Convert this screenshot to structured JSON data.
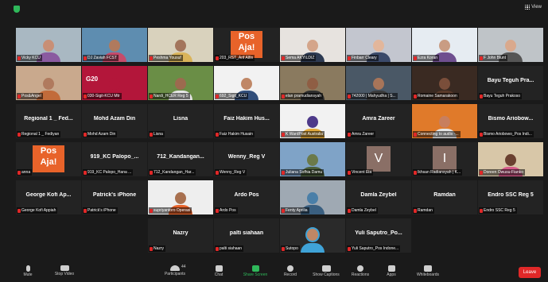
{
  "app": {
    "view_label": "View"
  },
  "tiles": [
    {
      "row": 0,
      "col": 0,
      "label": "Vicky KCU",
      "style": "photo",
      "bg": "#a9b8c2",
      "skin": "#c88f76",
      "shirt": "#8a5aa0",
      "active": true
    },
    {
      "row": 0,
      "col": 1,
      "label": "DJ Zaviah FCST",
      "style": "photo",
      "bg": "#5e8db0",
      "skin": "#b07a5e",
      "shirt": "#c64b6a"
    },
    {
      "row": 0,
      "col": 2,
      "label": "Peshma Yousuf",
      "style": "photo",
      "bg": "#d9d2bd",
      "skin": "#a3755c",
      "shirt": "#dab45a"
    },
    {
      "row": 0,
      "col": 3,
      "label": "203_RST_Arif Alfin",
      "style": "logo",
      "text": "Pos Aja!"
    },
    {
      "row": 0,
      "col": 4,
      "label": "Sema AKYILDIZ",
      "style": "photo",
      "bg": "#e7e3df",
      "skin": "#d4a58a",
      "shirt": "#2d3a52"
    },
    {
      "row": 0,
      "col": 5,
      "label": "Finbarr Cleary",
      "style": "photo",
      "bg": "#c3c6cf",
      "skin": "#e2b69b",
      "shirt": "#3b4a6a"
    },
    {
      "row": 0,
      "col": 6,
      "label": "Ezra Koran",
      "style": "photo",
      "bg": "#e6ecf2",
      "skin": "#c99c83",
      "shirt": "#6f4f8f"
    },
    {
      "row": 0,
      "col": 7,
      "label": "F John Blunt",
      "style": "photo",
      "bg": "#bfc4c8",
      "skin": "#d9a98d",
      "shirt": "#555555"
    },
    {
      "row": 1,
      "col": 0,
      "label": "Pos&Angel",
      "style": "photo",
      "bg": "#c9a98d",
      "skin": "#b07a5e",
      "shirt": "#c26b3a"
    },
    {
      "row": 1,
      "col": 1,
      "label": "030-Sigit-KCU Mtr",
      "style": "photo",
      "bg": "#b3163a",
      "skin": "#b3163a",
      "shirt": "#b3163a",
      "text": "G20"
    },
    {
      "row": 1,
      "col": 2,
      "label": "Nardi_HCER Reg 5",
      "style": "photo",
      "bg": "#6a8e46",
      "skin": "#9c6a4f",
      "shirt": "#e6e6e6"
    },
    {
      "row": 1,
      "col": 3,
      "label": "692_Sigit_KCU",
      "style": "photo",
      "bg": "#f2f2f2",
      "skin": "#c08766",
      "shirt": "#324e7a"
    },
    {
      "row": 1,
      "col": 4,
      "label": "elan pramudiansyah",
      "style": "photo",
      "bg": "#8a7a5f",
      "skin": "#8f5e44",
      "shirt": "#2e2e2e"
    },
    {
      "row": 1,
      "col": 5,
      "label": "742000 | Mahyudha | S...",
      "style": "photo",
      "bg": "#4a5866",
      "skin": "#a87559",
      "shirt": "#3b3b3b"
    },
    {
      "row": 1,
      "col": 6,
      "label": "Romaine Samarakoon",
      "style": "photo",
      "bg": "#3a2a22",
      "skin": "#7a4e3a",
      "shirt": "#5a3a2a"
    },
    {
      "row": 1,
      "col": 7,
      "label": "Bayu Teguh Prakoso",
      "style": "name",
      "name": "Bayu Teguh Pra..."
    },
    {
      "row": 2,
      "col": 0,
      "label": "Regional 1 _ Fediyan",
      "style": "name",
      "name": "Regional 1 _ Fed..."
    },
    {
      "row": 2,
      "col": 1,
      "label": "Mohd Azam Din",
      "style": "name",
      "name": "Mohd Azam Din"
    },
    {
      "row": 2,
      "col": 2,
      "label": "Lisna",
      "style": "name",
      "name": "Lisna"
    },
    {
      "row": 2,
      "col": 3,
      "label": "Faiz Hakim Husain",
      "style": "name",
      "name": "Faiz Hakim Hus..."
    },
    {
      "row": 2,
      "col": 4,
      "label": "K WardPost Australia",
      "style": "photo",
      "bg": "#f2f2f2",
      "skin": "#4e3a8a",
      "shirt": "#e3a93a"
    },
    {
      "row": 2,
      "col": 5,
      "label": "Amra Zareer",
      "style": "name",
      "name": "Amra Zareer"
    },
    {
      "row": 2,
      "col": 6,
      "label": "Connecting to audio -...",
      "style": "photo",
      "bg": "#e07a2a",
      "skin": "#c87f5e",
      "shirt": "#e6e6e6"
    },
    {
      "row": 2,
      "col": 7,
      "label": "Bismo Ariobowo_Pos Indi...",
      "style": "name",
      "name": "Bismo Ariobow..."
    },
    {
      "row": 3,
      "col": 0,
      "label": "anna",
      "style": "logo",
      "text": "Pos Aja!"
    },
    {
      "row": 3,
      "col": 1,
      "label": "919_KC Palopo_Hana ...",
      "style": "name",
      "name": "919_KC Palopo_..."
    },
    {
      "row": 3,
      "col": 2,
      "label": "712_Kandangan_Har...",
      "style": "name",
      "name": "712_Kandangan..."
    },
    {
      "row": 3,
      "col": 3,
      "label": "Wenny_Reg V",
      "style": "name",
      "name": "Wenny_Reg V"
    },
    {
      "row": 3,
      "col": 4,
      "label": "Juliana Sofhia Damu",
      "style": "photo",
      "bg": "#7fa3c7",
      "skin": "#6b7a4a",
      "shirt": "#4a5e3a"
    },
    {
      "row": 3,
      "col": 5,
      "label": "Vincent Eia",
      "style": "letter",
      "text": "V"
    },
    {
      "row": 3,
      "col": 6,
      "label": "Ikhsan Radiansyah | K...",
      "style": "letter",
      "text": "I"
    },
    {
      "row": 3,
      "col": 7,
      "label": "Doreen Owusu-Fianko",
      "style": "photo",
      "bg": "#d8c7a8",
      "skin": "#6a4030",
      "shirt": "#d65a8a"
    },
    {
      "row": 4,
      "col": 0,
      "label": "George Kofi Appiah",
      "style": "name",
      "name": "George Kofi Ap..."
    },
    {
      "row": 4,
      "col": 1,
      "label": "Patrick's iPhone",
      "style": "name",
      "name": "Patrick's iPhone"
    },
    {
      "row": 4,
      "col": 2,
      "label": "supriyantoro Operasi",
      "style": "photo",
      "bg": "#eeeeee",
      "skin": "#a8704f",
      "shirt": "#e8632a"
    },
    {
      "row": 4,
      "col": 3,
      "label": "Ardo Pos",
      "style": "name",
      "name": "Ardo Pos"
    },
    {
      "row": 4,
      "col": 4,
      "label": "Fenty Aprilia",
      "style": "photo",
      "bg": "#9fa9b3",
      "skin": "#4a7fa8",
      "shirt": "#3a5f80"
    },
    {
      "row": 4,
      "col": 5,
      "label": "Damla Zeybel",
      "style": "name",
      "name": "Damla Zeybel"
    },
    {
      "row": 4,
      "col": 6,
      "label": "Ramdan",
      "style": "name",
      "name": "Ramdan"
    },
    {
      "row": 4,
      "col": 7,
      "label": "Endro SSC Reg 5",
      "style": "name",
      "name": "Endro SSC Reg 5"
    },
    {
      "row": 5,
      "col": 2,
      "label": "Nazry",
      "style": "name",
      "name": "Nazry"
    },
    {
      "row": 5,
      "col": 3,
      "label": "palti siahaan",
      "style": "name",
      "name": "palti siahaan"
    },
    {
      "row": 5,
      "col": 4,
      "label": "Sutopo",
      "style": "photo",
      "bg": "#2a2a2a",
      "skin": "#c08766",
      "shirt": "#3fa3d8",
      "round": true
    },
    {
      "row": 5,
      "col": 5,
      "label": "Yuli Saputro_Pos Indone...",
      "style": "name",
      "name": "Yuli Saputro_Po..."
    }
  ],
  "toolbar": {
    "mute": "Mute",
    "stop_video": "Stop Video",
    "participants": "Participants",
    "participants_count": "44",
    "chat": "Chat",
    "share_screen": "Share Screen",
    "record": "Record",
    "show_captions": "Show Captions",
    "reactions": "Reactions",
    "apps": "Apps",
    "whiteboards": "Whiteboards",
    "leave": "Leave"
  }
}
